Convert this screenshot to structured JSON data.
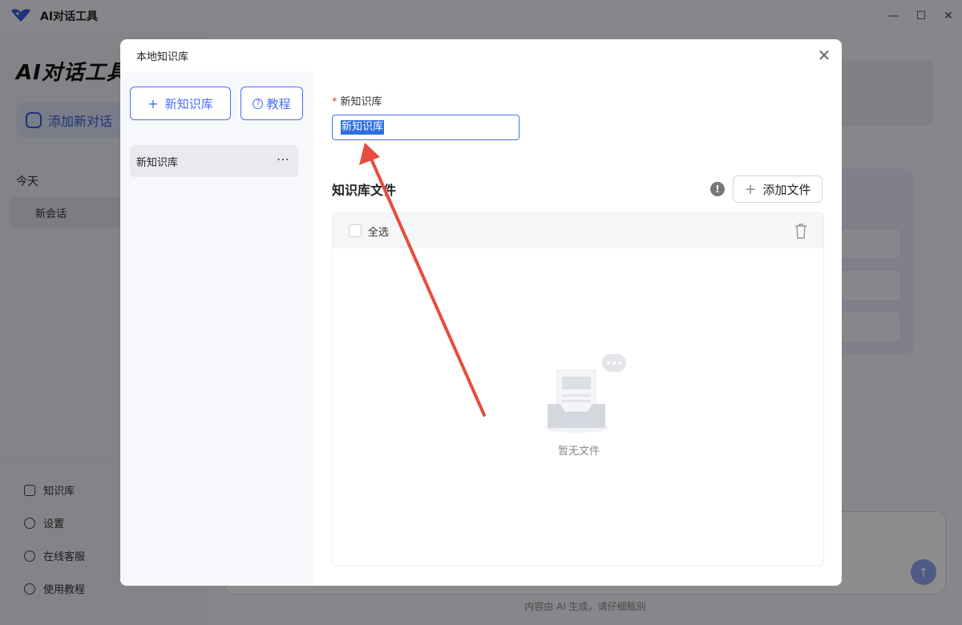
{
  "app": {
    "title": "AI对话工具",
    "brand": "AI对话工具",
    "new_chat": "添加新对话",
    "section_today": "今天",
    "conversations": [
      {
        "label": "新会话"
      }
    ],
    "side_links": {
      "knowledge": "知识库",
      "settings": "设置",
      "support": "在线客服",
      "tutorial": "使用教程"
    },
    "footer_note": "内容由 AI 生成，请仔细甄别"
  },
  "modal": {
    "title": "本地知识库",
    "new_kb_button": "新知识库",
    "tutorial_button": "教程",
    "kb_list": [
      {
        "label": "新知识库"
      }
    ],
    "field_label": "新知识库",
    "name_value": "新知识库",
    "files_title": "知识库文件",
    "add_file_button": "添加文件",
    "select_all": "全选",
    "empty_text": "暂无文件"
  },
  "colors": {
    "accent": "#4a6cf7",
    "arrow": "#e74c3c",
    "required": "#e53935"
  }
}
